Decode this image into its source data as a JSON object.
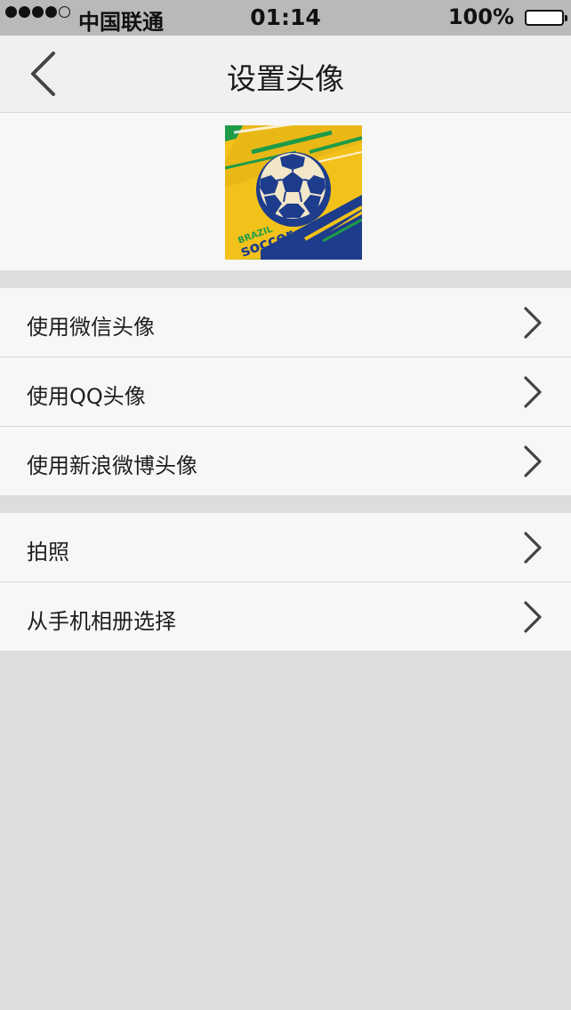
{
  "status": {
    "carrier": "中国联通",
    "time": "01:14",
    "battery": "100%",
    "signal_bars": 4,
    "signal_total": 5
  },
  "nav": {
    "back_icon": "chevron-left-icon",
    "title": "设置头像"
  },
  "avatar": {
    "brand_word": "BRAZIL",
    "sport_word": "soccer",
    "colors": {
      "green": "#1f9b48",
      "yellow": "#f2c21b",
      "blue": "#1d3c8c"
    }
  },
  "group1": [
    {
      "label": "使用微信头像"
    },
    {
      "label": "使用QQ头像"
    },
    {
      "label": "使用新浪微博头像"
    }
  ],
  "group2": [
    {
      "label": "拍照"
    },
    {
      "label": "从手机相册选择"
    }
  ]
}
